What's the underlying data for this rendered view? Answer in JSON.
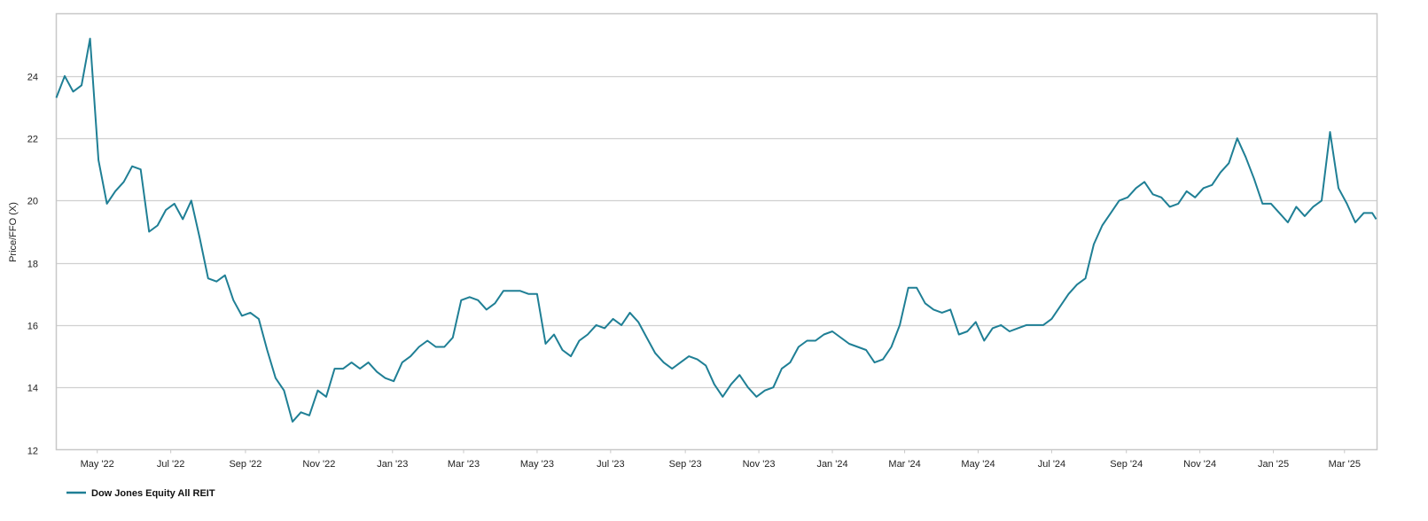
{
  "chart_data": {
    "type": "line",
    "title": "",
    "xlabel": "",
    "ylabel": "Price/FFO (X)",
    "ylim": [
      12,
      26
    ],
    "yticks": [
      12,
      14,
      16,
      18,
      20,
      22,
      24
    ],
    "xlim": [
      "2022-03-28",
      "2025-03-28"
    ],
    "x_sampling": {
      "start": "2022-03-28",
      "step_days": 7
    },
    "xticks": [
      {
        "date": "2022-05-01",
        "label": "May '22"
      },
      {
        "date": "2022-07-01",
        "label": "Jul '22"
      },
      {
        "date": "2022-09-01",
        "label": "Sep '22"
      },
      {
        "date": "2022-11-01",
        "label": "Nov '22"
      },
      {
        "date": "2023-01-01",
        "label": "Jan '23"
      },
      {
        "date": "2023-03-01",
        "label": "Mar '23"
      },
      {
        "date": "2023-05-01",
        "label": "May '23"
      },
      {
        "date": "2023-07-01",
        "label": "Jul '23"
      },
      {
        "date": "2023-09-01",
        "label": "Sep '23"
      },
      {
        "date": "2023-11-01",
        "label": "Nov '23"
      },
      {
        "date": "2024-01-01",
        "label": "Jan '24"
      },
      {
        "date": "2024-03-01",
        "label": "Mar '24"
      },
      {
        "date": "2024-05-01",
        "label": "May '24"
      },
      {
        "date": "2024-07-01",
        "label": "Jul '24"
      },
      {
        "date": "2024-09-01",
        "label": "Sep '24"
      },
      {
        "date": "2024-11-01",
        "label": "Nov '24"
      },
      {
        "date": "2025-01-01",
        "label": "Jan '25"
      },
      {
        "date": "2025-03-01",
        "label": "Mar '25"
      }
    ],
    "grid": true,
    "legend_position": "bottom-left",
    "series": [
      {
        "name": "Dow Jones Equity All REIT",
        "color": "#1f7f95",
        "values": [
          23.3,
          24.0,
          23.5,
          23.7,
          25.2,
          21.3,
          19.9,
          20.3,
          20.6,
          21.1,
          21.0,
          19.0,
          19.2,
          19.7,
          19.9,
          19.4,
          20.0,
          18.8,
          17.5,
          17.4,
          17.6,
          16.8,
          16.3,
          16.4,
          16.2,
          15.2,
          14.3,
          13.9,
          12.9,
          13.2,
          13.1,
          13.9,
          13.7,
          14.6,
          14.6,
          14.8,
          14.6,
          14.8,
          14.5,
          14.3,
          14.2,
          14.8,
          15.0,
          15.3,
          15.5,
          15.3,
          15.3,
          15.6,
          16.8,
          16.9,
          16.8,
          16.5,
          16.7,
          17.1,
          17.1,
          17.1,
          17.0,
          17.0,
          15.4,
          15.7,
          15.2,
          15.0,
          15.5,
          15.7,
          16.0,
          15.9,
          16.2,
          16.0,
          16.4,
          16.1,
          15.6,
          15.1,
          14.8,
          14.6,
          14.8,
          15.0,
          14.9,
          14.7,
          14.1,
          13.7,
          14.1,
          14.4,
          14.0,
          13.7,
          13.9,
          14.0,
          14.6,
          14.8,
          15.3,
          15.5,
          15.5,
          15.7,
          15.8,
          15.6,
          15.4,
          15.3,
          15.2,
          14.8,
          14.9,
          15.3,
          16.0,
          17.2,
          17.2,
          16.7,
          16.5,
          16.4,
          16.5,
          15.7,
          15.8,
          16.1,
          15.5,
          15.9,
          16.0,
          15.8,
          15.9,
          16.0,
          16.0,
          16.0,
          16.2,
          16.6,
          17.0,
          17.3,
          17.5,
          18.6,
          19.2,
          19.6,
          20.0,
          20.1,
          20.4,
          20.6,
          20.2,
          20.1,
          19.8,
          19.9,
          20.3,
          20.1,
          20.4,
          20.5,
          20.9,
          21.2,
          22.0,
          21.4,
          20.7,
          19.9,
          19.9,
          19.6,
          19.3,
          19.8,
          19.5,
          19.8,
          20.0,
          22.2,
          20.4,
          19.9,
          19.3,
          19.6,
          19.6,
          19.4
        ]
      }
    ]
  }
}
